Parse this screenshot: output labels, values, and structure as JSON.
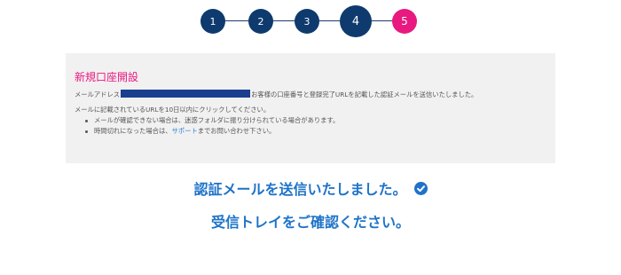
{
  "stepper": {
    "steps": [
      "1",
      "2",
      "3",
      "4",
      "5"
    ],
    "current": 4,
    "colors": {
      "done": "#0e3a6e",
      "todo": "#e8197f"
    }
  },
  "panel": {
    "title": "新規口座開設",
    "email_prefix": "メールアドレス",
    "email_suffix": "お客様の口座番号と登録完了URLを記載した認証メールを送信いたしました。",
    "expiry_note": "メールに記載されているURLを10日以内にクリックしてください。",
    "bullet1": "メールが確認できない場合は、迷惑フォルダに振り分けられている場合があります。",
    "bullet2_prefix": "時間切れになった場合は、",
    "bullet2_link": "サポート",
    "bullet2_suffix": "までお問い合わせ下さい。"
  },
  "confirmation": {
    "sent_message": "認証メールを送信いたしました。",
    "check_icon": "check-circle-icon",
    "inbox_message": "受信トレイをご確認ください。"
  },
  "colors": {
    "accent_blue": "#1e73c8",
    "pink": "#e8197f",
    "link": "#2b7bd1"
  }
}
